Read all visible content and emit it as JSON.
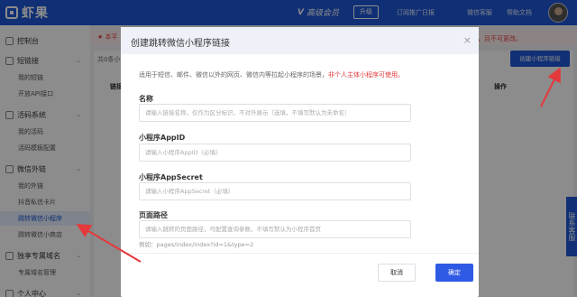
{
  "topbar": {
    "logo_text": "虾果",
    "vip_badge": "V",
    "vip_label": "高级会员",
    "upgrade_label": "升级",
    "nav": [
      "订阅推广日报",
      "微信客服",
      "帮助文档"
    ]
  },
  "sidebar": {
    "groups": [
      {
        "label": "控制台",
        "items": []
      },
      {
        "label": "短链接",
        "items": [
          "我的短链",
          "开放API接口"
        ]
      },
      {
        "label": "活码系统",
        "items": [
          "我的活码",
          "活码模板配置"
        ]
      },
      {
        "label": "微信外链",
        "items": [
          "我的外链",
          "抖音私信卡片",
          "跳转微信小程序",
          "跳转微信小商店"
        ]
      },
      {
        "label": "独享专属域名",
        "items": [
          "专属域名管理"
        ]
      },
      {
        "label": "个人中心",
        "items": []
      }
    ],
    "active_item": "跳转微信小程序"
  },
  "main": {
    "notice_head": "★ 本平",
    "notice_tail": "，且不可更改。",
    "count_text": "共0条小",
    "create_button": "创建小程序链接",
    "col_link": "链接",
    "col_ops": "操作"
  },
  "side_help": "联系客服",
  "modal": {
    "title": "创建跳转微信小程序链接",
    "close": "×",
    "desc": "适用于短信、邮件、微信以外的网页、微信内等拉起小程序的场景，",
    "desc_warn": "非个人主体小程序可使用。",
    "fields": [
      {
        "label": "名称",
        "placeholder": "请输入链接名称，仅作为区分标识，不对外展示（选填，不填写默认为未命名）"
      },
      {
        "label": "小程序AppID",
        "placeholder": "请输入小程序AppID（必填）"
      },
      {
        "label": "小程序AppSecret",
        "placeholder": "请输入小程序AppSecret（必填）"
      },
      {
        "label": "页面路径",
        "placeholder": "请输入跳转的页面路径，可配置查询参数，不填写默认为小程序首页"
      }
    ],
    "hint": "例如：pages/index/index?id=1&type=2",
    "cancel": "取消",
    "ok": "确定"
  },
  "colors": {
    "brand": "#1e57d6",
    "warn": "#e4393c",
    "arrow": "#e4393c"
  }
}
